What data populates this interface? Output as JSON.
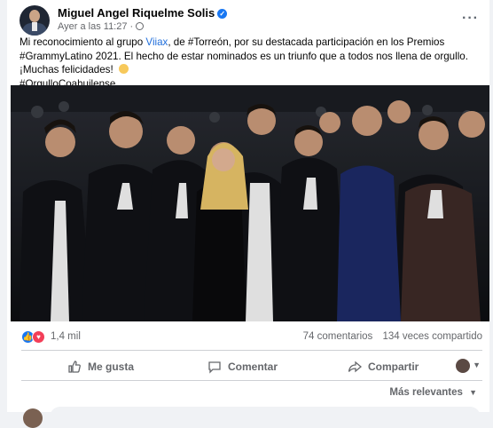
{
  "post": {
    "author": "Miguel Angel Riquelme Solis",
    "time": "Ayer a las 11:27",
    "time_separator": "·",
    "more_label": "···",
    "text": {
      "p1_a": "Mi reconocimiento al grupo ",
      "p1_link": "Viiax",
      "p1_b": ", de #Torreón, por su destacada participación en los Premios #GrammyLatino 2021. El hecho de estar nominados es un triunfo que a todos nos llena de orgullo. ¡Muchas felicidades! ",
      "hashtag": "#OrgulloCoahuilense"
    },
    "icons": [
      "verified-badge-icon",
      "globe-icon",
      "clapping-hands-emoji",
      "more-options-icon"
    ]
  },
  "stats": {
    "reaction_count": "1,4 mil",
    "comments": "74 comentarios",
    "shares": "134 veces compartido",
    "reaction_icons": [
      "like-reaction-icon",
      "love-reaction-icon"
    ]
  },
  "actions": {
    "like": "Me gusta",
    "comment": "Comentar",
    "share": "Compartir"
  },
  "sort": {
    "label": "Más relevantes"
  },
  "colors": {
    "facebook_blue": "#1877f2",
    "love_red": "#f33e58",
    "link": "#216fdb",
    "secondary_text": "#65676b"
  }
}
